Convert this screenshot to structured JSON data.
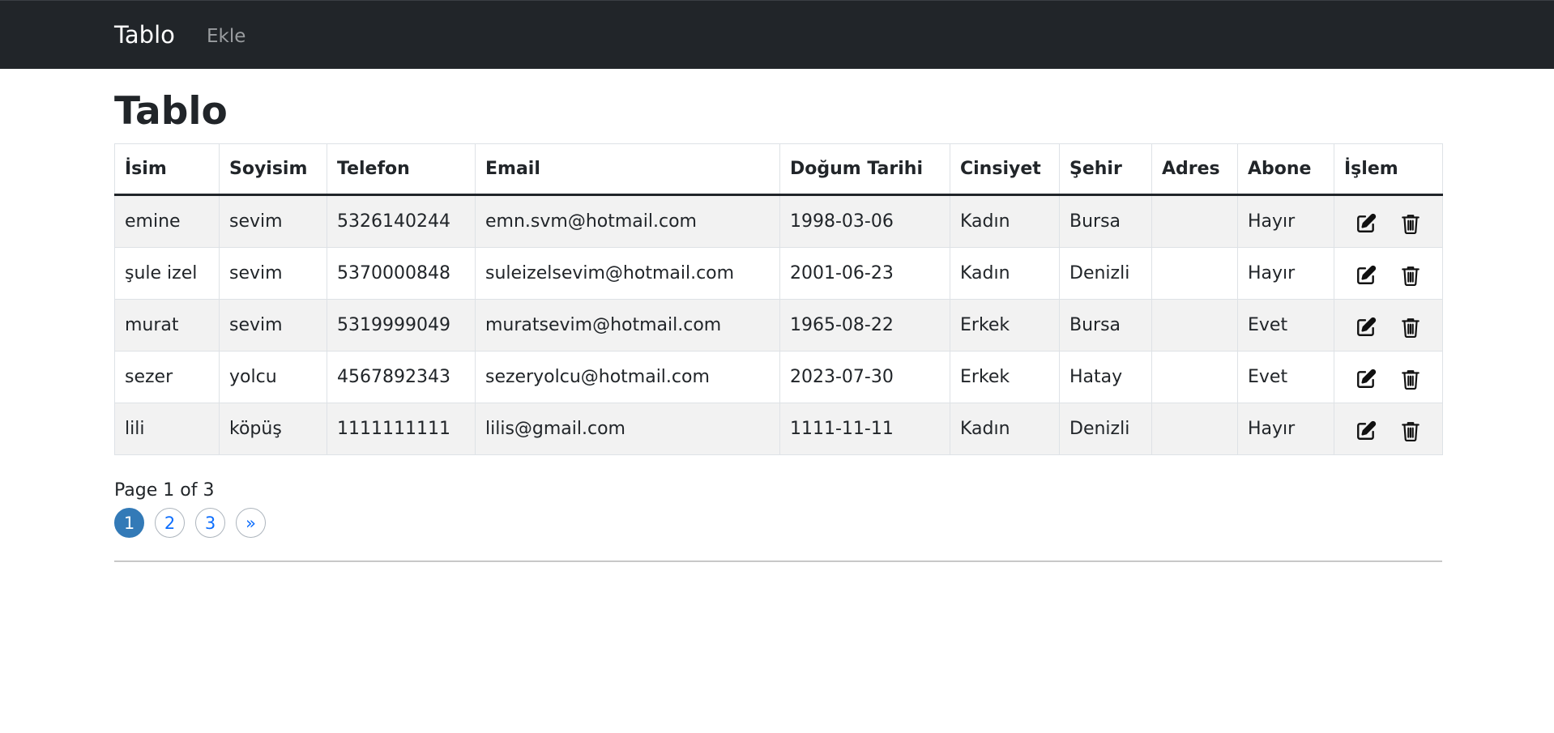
{
  "navbar": {
    "brand": "Tablo",
    "links": [
      "Ekle"
    ]
  },
  "page": {
    "title": "Tablo"
  },
  "table": {
    "headers": [
      "İsim",
      "Soyisim",
      "Telefon",
      "Email",
      "Doğum Tarihi",
      "Cinsiyet",
      "Şehir",
      "Adres",
      "Abone",
      "İşlem"
    ],
    "rows": [
      [
        "emine",
        "sevim",
        "5326140244",
        "emn.svm@hotmail.com",
        "1998-03-06",
        "Kadın",
        "Bursa",
        "",
        "Hayır"
      ],
      [
        "şule izel",
        "sevim",
        "5370000848",
        "suleizelsevim@hotmail.com",
        "2001-06-23",
        "Kadın",
        "Denizli",
        "",
        "Hayır"
      ],
      [
        "murat",
        "sevim",
        "5319999049",
        "muratsevim@hotmail.com",
        "1965-08-22",
        "Erkek",
        "Bursa",
        "",
        "Evet"
      ],
      [
        "sezer",
        "yolcu",
        "4567892343",
        "sezeryolcu@hotmail.com",
        "2023-07-30",
        "Erkek",
        "Hatay",
        "",
        "Evet"
      ],
      [
        "lili",
        "köpüş",
        "1111111111",
        "lilis@gmail.com",
        "1111-11-11",
        "Kadın",
        "Denizli",
        "",
        "Hayır"
      ]
    ],
    "row_actions": [
      "edit-icon",
      "trash-icon"
    ]
  },
  "pagination": {
    "info": "Page 1 of 3",
    "pages": [
      "1",
      "2",
      "3",
      "»"
    ],
    "current": 1
  },
  "colors": {
    "navbar_bg": "#212529",
    "active_page": "#337ab7",
    "link": "#0d6efd",
    "stripe": "#f2f2f2"
  }
}
